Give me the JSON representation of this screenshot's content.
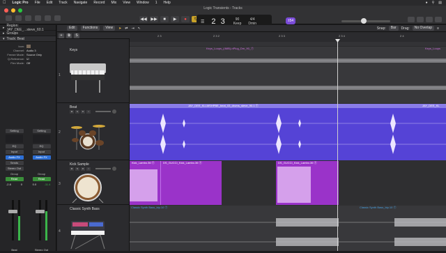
{
  "menubar": {
    "items": [
      "Logic Pro",
      "File",
      "Edit",
      "Track",
      "Navigate",
      "Record",
      "Mix",
      "View",
      "Window",
      "1",
      "Help"
    ]
  },
  "window": {
    "title": "Logic Transients - Tracks"
  },
  "transport": {
    "position": "2 3",
    "tempo": "90",
    "tempo_label": "Keep",
    "signature": "4/4",
    "key": "Dmin",
    "badge": "±54"
  },
  "toolbar": {
    "edit": "Edit",
    "functions": "Functions",
    "view": "View",
    "snap_label": "Snap:",
    "snap_value": "Bar",
    "drag_label": "Drag:",
    "drag_value": "No Overlap"
  },
  "inspector": {
    "region_row": "Region: JAY_DEE_...steve_60.1",
    "groups_row": "Groups",
    "track_row": "Track: Beat",
    "params": [
      {
        "k": "Icon:",
        "v": ""
      },
      {
        "k": "Channel:",
        "v": "Audio 3"
      },
      {
        "k": "Freeze Mode:",
        "v": "Source Only"
      },
      {
        "k": "Q-Reference:",
        "v": ""
      },
      {
        "k": "Flex Mode:",
        "v": "Off"
      }
    ],
    "strip1": {
      "setting": "Setting",
      "eq": "EQ",
      "input": "Input",
      "fx": "Audio FX",
      "sends": "Sends",
      "output": "Stereo Out",
      "group": "Group",
      "auto": "Read",
      "val1": "-2.8",
      "val2": "0",
      "name": "Beat"
    },
    "strip2": {
      "setting": "Setting",
      "eq": "EQ",
      "input": "Input",
      "fx": "Audio FX",
      "sends": "",
      "output": "",
      "group": "Group",
      "auto": "Read",
      "val1": "0.0",
      "val2": "-11.4",
      "name": "Stereo Out"
    }
  },
  "ruler": {
    "ticks": [
      "2 3",
      "2 3 2",
      "2 3 3",
      "2 3 4",
      "2 4"
    ]
  },
  "tracks": [
    {
      "num": "1",
      "name": "Keys",
      "instrument": "electric-piano"
    },
    {
      "num": "2",
      "name": "Beat",
      "instrument": "drum-kit"
    },
    {
      "num": "3",
      "name": "Kick Sample",
      "instrument": "kick-drum"
    },
    {
      "num": "4",
      "name": "Classic Synth Bass",
      "instrument": "synthesizer"
    }
  ],
  "regions": {
    "keys_a": "Keys_Loops_(4MB)-nPlug_Dm_90_Ⓣ",
    "keys_b": "Keys_Loops",
    "beat": "JAY_DEE_KLLMSHPBE_beat_03_drums_steve_90.1 Ⓣ",
    "beat_b": "JAY_DEE_KL",
    "kick_a": "Kick_Lambo.36 Ⓣ",
    "kick_b": "DS_GUCCI_Kick_Lambo.36 Ⓣ",
    "kick_c": "DS_GUCCI_Kick_Lambo.36 Ⓣ",
    "bass_a": "Classic Synth Bass_bip.10 Ⓣ",
    "bass_b": "Classic Synth Bass_bip.10 Ⓣ"
  },
  "colors": {
    "keys": "#5a5a5e",
    "beat": "#5a4ad9",
    "kick": "#9a33c9",
    "bass": "#4a4a4e"
  }
}
